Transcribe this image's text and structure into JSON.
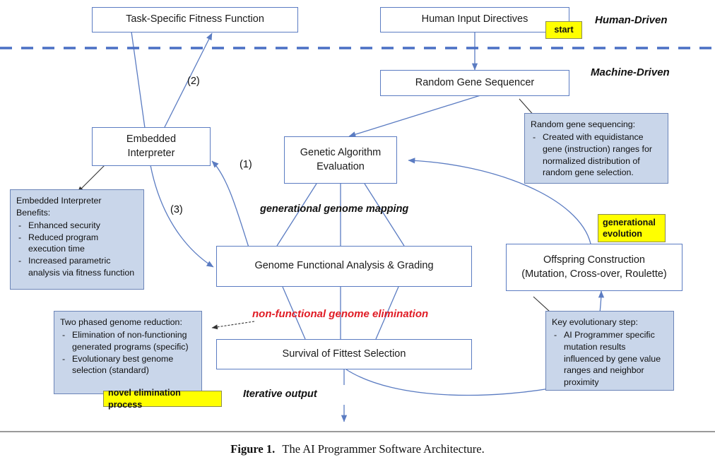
{
  "figure": {
    "caption_label": "Figure 1.",
    "caption_text": "The AI Programmer Software Architecture."
  },
  "lanes": [
    {
      "name": "human",
      "label": "Human-Driven"
    },
    {
      "name": "machine",
      "label": "Machine-Driven"
    }
  ],
  "nodes": {
    "fitness_function": "Task-Specific Fitness Function",
    "human_input": "Human Input Directives",
    "random_gene_sequencer": "Random Gene Sequencer",
    "embedded_interpreter": "Embedded\nInterpreter",
    "embedded_interpreter_l1": "Embedded",
    "embedded_interpreter_l2": "Interpreter",
    "genetic_algorithm_l1": "Genetic Algorithm",
    "genetic_algorithm_l2": "Evaluation",
    "genome_analysis": "Genome Functional Analysis & Grading",
    "offspring_l1": "Offspring Construction",
    "offspring_l2": "(Mutation, Cross-over, Roulette)",
    "survival": "Survival of Fittest Selection"
  },
  "notes": {
    "random_sequencing": {
      "header": "Random gene sequencing:",
      "items": [
        "Created with equidistance gene (instruction) ranges for normalized distribution of random gene selection."
      ]
    },
    "interpreter_benefits": {
      "header": "Embedded Interpreter Benefits:",
      "items": [
        "Enhanced security",
        "Reduced program execution time",
        "Increased parametric analysis via fitness function"
      ]
    },
    "genome_reduction": {
      "header": "Two phased genome reduction:",
      "items": [
        "Elimination of non-functioning generated programs (specific)",
        "Evolutionary best genome selection (standard)"
      ]
    },
    "evolutionary_step": {
      "header": "Key evolutionary step:",
      "items": [
        "AI Programmer specific mutation results influenced by gene value ranges and neighbor proximity"
      ]
    }
  },
  "badges": {
    "start": "start",
    "generational_evolution_l1": "generational",
    "generational_evolution_l2": "evolution",
    "novel_elimination": "novel elimination process"
  },
  "edge_labels": {
    "step1": "(1)",
    "step2": "(2)",
    "step3": "(3)",
    "genome_mapping": "generational genome mapping",
    "elimination": "non-functional genome elimination",
    "iterative_output": "Iterative output"
  },
  "colors": {
    "flow_blue": "#5b7cc2",
    "note_fill": "#c9d6ea",
    "note_border": "#6b84b8",
    "badge_yellow": "#ffff00",
    "badge_border": "#8a8a55",
    "elimination_red": "#e01b24",
    "rule_gray": "#9a9a9a"
  }
}
